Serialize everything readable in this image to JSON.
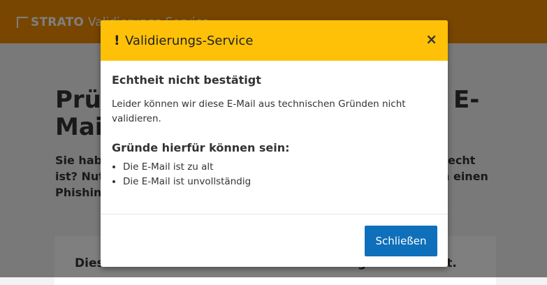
{
  "header": {
    "brand": "STRATO",
    "sub": "Validierungs-Service"
  },
  "background": {
    "heading_left_line1": "Prüf",
    "heading_left_line2": "Mail",
    "heading_right": "E-",
    "text_line1_left": "Sie haben",
    "text_line1_right": "echt",
    "text_line2_left": "ist? Nutze",
    "text_line2_right": "n einen",
    "text_line3_left": "Phishing-",
    "card_title": "Dieses Formular hilft Ihnen bei der Prüfung der Echtheit."
  },
  "modal": {
    "title": "Validierungs-Service",
    "warning_glyph": "!",
    "close_glyph": "×",
    "heading": "Echtheit nicht bestätigt",
    "text": "Leider können wir diese E-Mail aus technischen Gründen nicht validieren.",
    "reasons_heading": "Gründe hierfür können sein:",
    "reasons": [
      "Die E-Mail ist zu alt",
      "Die E-Mail ist unvollständig"
    ],
    "button": "Schließen"
  },
  "colors": {
    "topbar": "#f18c00",
    "modal_header": "#ffc107",
    "primary_button": "#0e6fba"
  }
}
